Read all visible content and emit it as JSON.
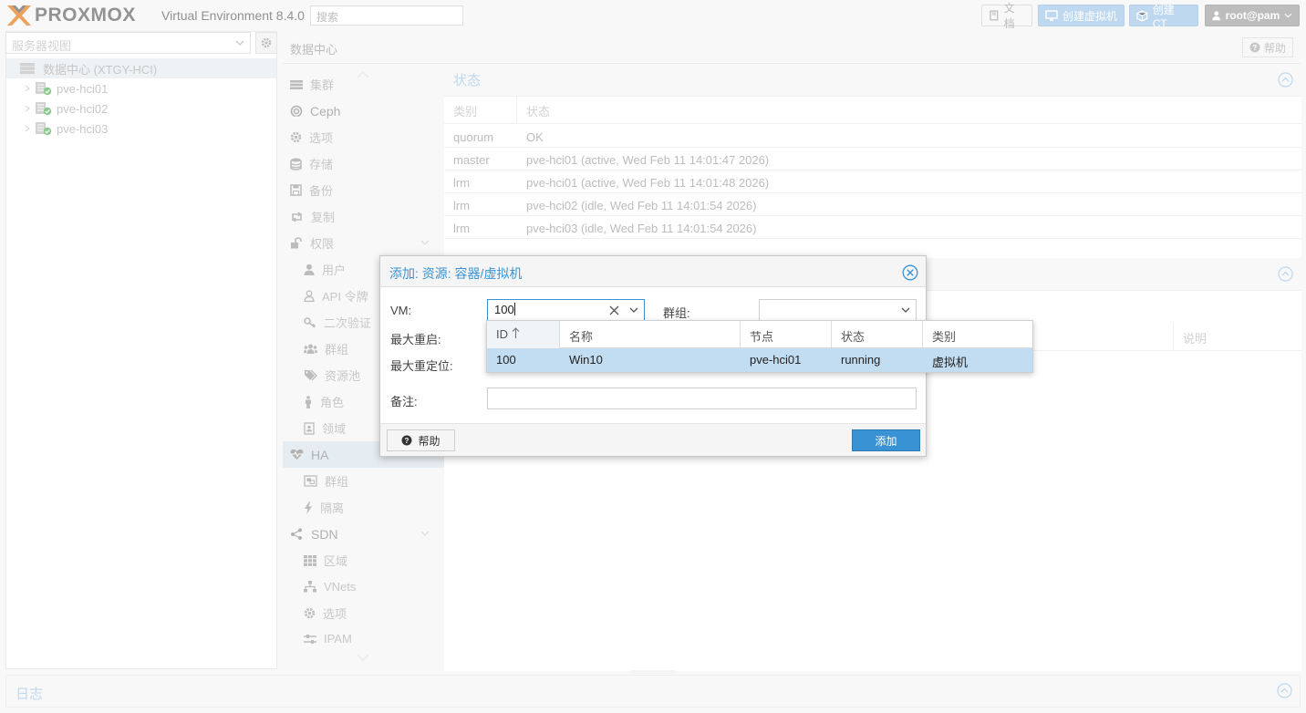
{
  "topbar": {
    "logo_text": "PROXMOX",
    "version": "Virtual Environment 8.4.0",
    "search_placeholder": "搜索",
    "docs_label": "文档",
    "create_vm_label": "创建虚拟机",
    "create_ct_label": "创建 CT",
    "user_label": "root@pam"
  },
  "left": {
    "view_selector": "服务器视图",
    "tree": [
      {
        "label": "数据中心 (XTGY-HCI)",
        "icon": "datacenter-icon"
      },
      {
        "label": "pve-hci01",
        "icon": "node-online-icon"
      },
      {
        "label": "pve-hci02",
        "icon": "node-online-icon"
      },
      {
        "label": "pve-hci03",
        "icon": "node-online-icon"
      }
    ]
  },
  "main": {
    "title": "数据中心",
    "help_label": "帮助",
    "menu": [
      {
        "label": "集群",
        "icon": "cluster-icon"
      },
      {
        "label": "Ceph",
        "icon": "ceph-icon"
      },
      {
        "label": "选项",
        "icon": "gear-icon"
      },
      {
        "label": "存储",
        "icon": "database-icon"
      },
      {
        "label": "备份",
        "icon": "floppy-icon"
      },
      {
        "label": "复制",
        "icon": "retweet-icon"
      },
      {
        "label": "权限",
        "icon": "unlock-icon"
      },
      {
        "label": "用户",
        "icon": "user-icon"
      },
      {
        "label": "API 令牌",
        "icon": "user-outline-icon"
      },
      {
        "label": "二次验证",
        "icon": "key-icon"
      },
      {
        "label": "群组",
        "icon": "users-icon"
      },
      {
        "label": "资源池",
        "icon": "tags-icon"
      },
      {
        "label": "角色",
        "icon": "male-icon"
      },
      {
        "label": "领域",
        "icon": "address-book-icon"
      },
      {
        "label": "HA",
        "icon": "heartbeat-icon"
      },
      {
        "label": "群组",
        "icon": "object-group-icon"
      },
      {
        "label": "隔离",
        "icon": "bolt-icon"
      },
      {
        "label": "SDN",
        "icon": "sdn-icon"
      },
      {
        "label": "区域",
        "icon": "grid-icon"
      },
      {
        "label": "VNets",
        "icon": "sitemap-icon"
      },
      {
        "label": "选项",
        "icon": "gear-icon"
      },
      {
        "label": "IPAM",
        "icon": "ipam-icon"
      }
    ],
    "status_panel": {
      "title": "状态",
      "columns": [
        "类别",
        "状态"
      ],
      "rows": [
        {
          "type": "quorum",
          "status": "OK"
        },
        {
          "type": "master",
          "status": "pve-hci01 (active, Wed Feb 11 14:01:47 2026)"
        },
        {
          "type": "lrm",
          "status": "pve-hci01 (active, Wed Feb 11 14:01:48 2026)"
        },
        {
          "type": "lrm",
          "status": "pve-hci02 (idle, Wed Feb 11 14:01:54 2026)"
        },
        {
          "type": "lrm",
          "status": "pve-hci03 (idle, Wed Feb 11 14:01:54 2026)"
        }
      ]
    },
    "resources_panel": {
      "desc_header": "说明"
    }
  },
  "log_panel": {
    "title": "日志"
  },
  "dialog": {
    "title": "添加: 资源: 容器/虚拟机",
    "vm_label": "VM:",
    "vm_value": "100",
    "group_label": "群组:",
    "max_restart_label": "最大重启:",
    "max_relocate_label": "最大重定位:",
    "notes_label": "备注:",
    "help_label": "帮助",
    "add_label": "添加",
    "picker": {
      "columns": [
        "ID",
        "名称",
        "节点",
        "状态",
        "类别"
      ],
      "rows": [
        {
          "id": "100",
          "name": "Win10",
          "node": "pve-hci01",
          "status": "running",
          "type": "虚拟机"
        }
      ]
    }
  },
  "colors": {
    "accent": "#3892d4",
    "selected_row": "#c2ddf2",
    "logo_x": "#e57000",
    "online_check": "#4caf50"
  }
}
